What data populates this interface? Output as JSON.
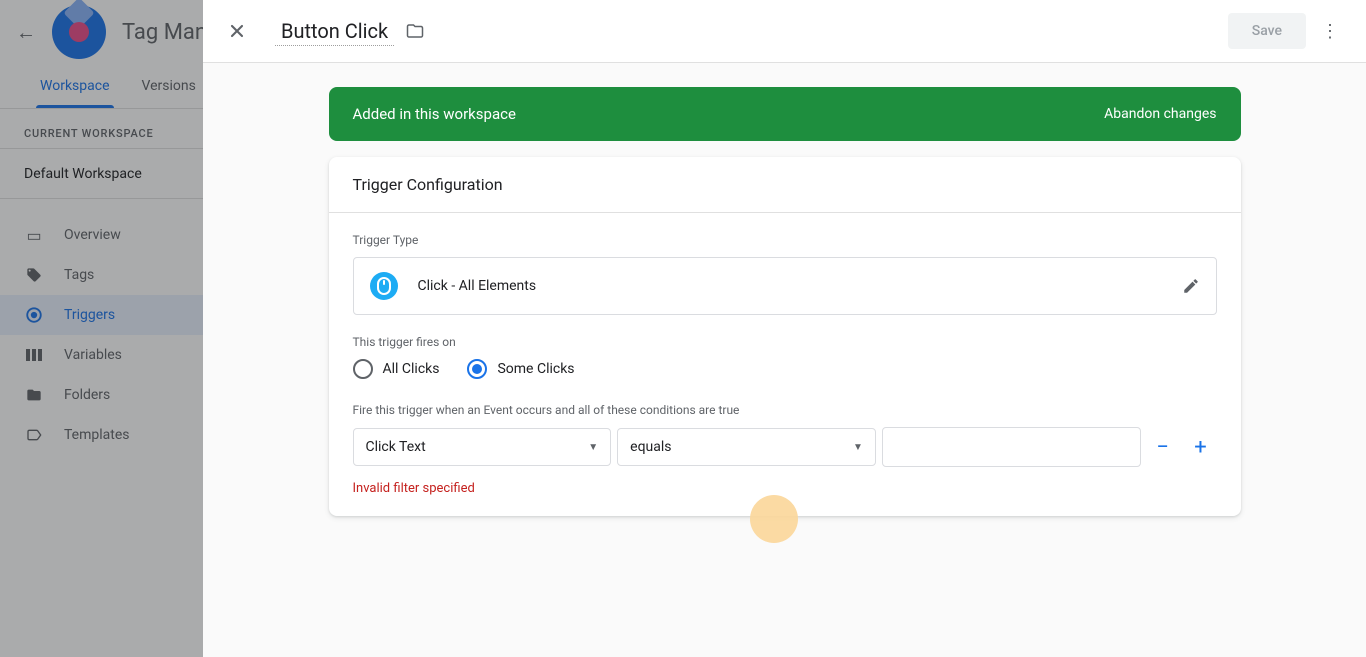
{
  "app": {
    "title": "Tag Manager"
  },
  "bg_tabs": {
    "workspace": "Workspace",
    "versions": "Versions"
  },
  "workspace": {
    "label": "CURRENT WORKSPACE",
    "name": "Default Workspace"
  },
  "nav": {
    "overview": "Overview",
    "tags": "Tags",
    "triggers": "Triggers",
    "variables": "Variables",
    "folders": "Folders",
    "templates": "Templates"
  },
  "panel": {
    "title": "Button Click",
    "save": "Save"
  },
  "banner": {
    "text": "Added in this workspace",
    "action": "Abandon changes"
  },
  "card": {
    "header": "Trigger Configuration",
    "type_label": "Trigger Type",
    "type_value": "Click - All Elements",
    "fires_on_label": "This trigger fires on",
    "radio_all": "All Clicks",
    "radio_some": "Some Clicks",
    "conditions_label": "Fire this trigger when an Event occurs and all of these conditions are true",
    "filter_var": "Click Text",
    "filter_op": "equals",
    "filter_val": "",
    "error": "Invalid filter specified"
  }
}
